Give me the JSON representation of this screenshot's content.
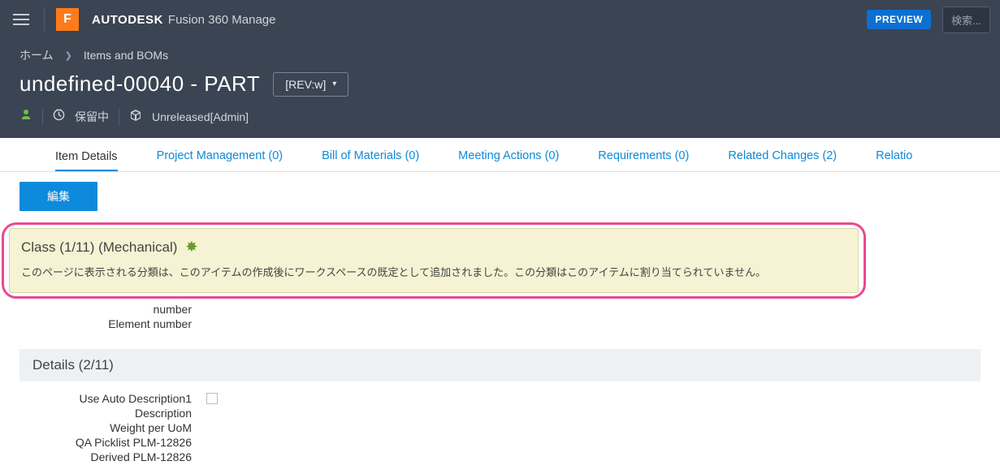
{
  "topbar": {
    "brand_strong": "AUTODESK",
    "brand_rest": "Fusion 360 Manage",
    "preview": "PREVIEW",
    "search_placeholder": "検索..."
  },
  "breadcrumb": {
    "home": "ホーム",
    "section": "Items and BOMs"
  },
  "page": {
    "title": "undefined-00040 - PART",
    "rev_label": "[REV:w]",
    "pending": "保留中",
    "status": "Unreleased[Admin]"
  },
  "tabs": [
    {
      "label": "Item Details",
      "active": true
    },
    {
      "label": "Project Management (0)"
    },
    {
      "label": "Bill of Materials (0)"
    },
    {
      "label": "Meeting Actions (0)"
    },
    {
      "label": "Requirements (0)"
    },
    {
      "label": "Related Changes (2)"
    },
    {
      "label": "Relatio"
    }
  ],
  "buttons": {
    "edit": "編集"
  },
  "class_section": {
    "title": "Class (1/11) (Mechanical)",
    "message": "このページに表示される分類は、このアイテムの作成後にワークスペースの既定として追加されました。この分類はこのアイテムに割り当てられていません。"
  },
  "orphan_fields": {
    "number": "number",
    "element_number": "Element number"
  },
  "details_section": {
    "title": "Details (2/11)",
    "fields": {
      "use_auto_desc": "Use Auto Description1",
      "description": "Description",
      "weight_per_uom": "Weight per UoM",
      "qa_picklist": "QA Picklist PLM-12826",
      "derived": "Derived PLM-12826"
    }
  }
}
